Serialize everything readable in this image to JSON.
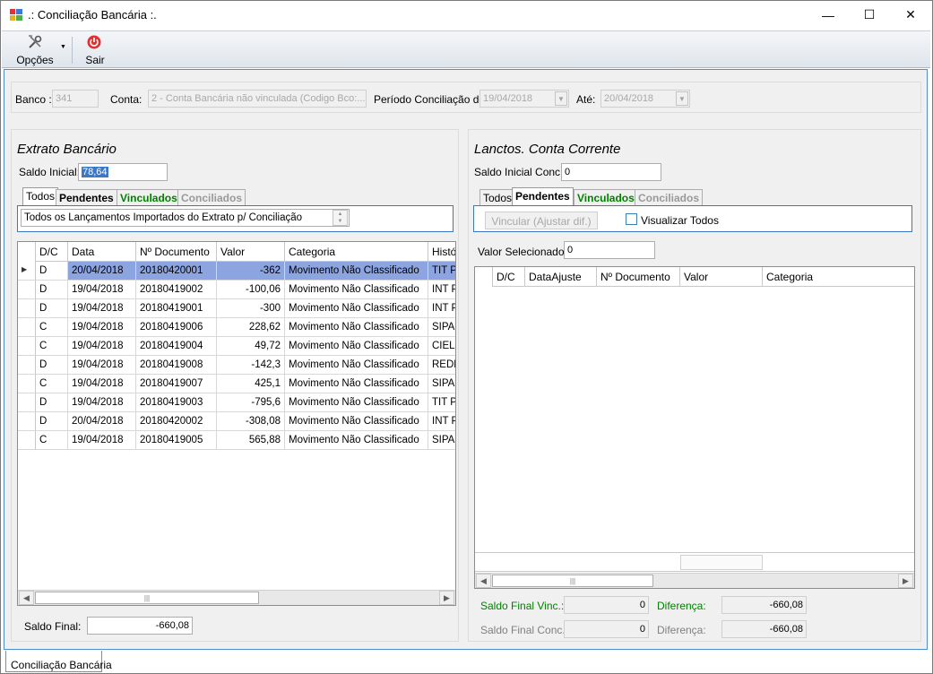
{
  "window": {
    "title": ".: Conciliação Bancária :.",
    "minimize_glyph": "—",
    "maximize_glyph": "☐",
    "close_glyph": "✕"
  },
  "toolbar": {
    "options_label": "Opções",
    "exit_label": "Sair"
  },
  "header": {
    "banco_label": "Banco :",
    "banco_value": "341",
    "conta_label": "Conta:",
    "conta_value": "2 - Conta Bancária não vinculada (Codigo Bco:...",
    "periodo_label": "Período Conciliação de :",
    "periodo_de": "19/04/2018",
    "ate_label": "Até:",
    "periodo_ate": "20/04/2018"
  },
  "left": {
    "title": "Extrato Bancário",
    "saldo_inicial_label": "Saldo Inicial:",
    "saldo_inicial_value": "78,64",
    "tabs": [
      "Todos",
      "Pendentes",
      "Vinculados",
      "Conciliados"
    ],
    "tab_description": "Todos os Lançamentos Importados do Extrato p/ Conciliação",
    "columns": [
      "D/C",
      "Data",
      "Nº Documento",
      "Valor",
      "Categoria",
      "Históri"
    ],
    "rows": [
      [
        "D",
        "20/04/2018",
        "20180420001",
        "-362",
        "Movimento Não Classificado",
        "TIT PA"
      ],
      [
        "D",
        "19/04/2018",
        "20180419002",
        "-100,06",
        "Movimento Não Classificado",
        "INT PA"
      ],
      [
        "D",
        "19/04/2018",
        "20180419001",
        "-300",
        "Movimento Não Classificado",
        "INT PA"
      ],
      [
        "C",
        "19/04/2018",
        "20180419006",
        "228,62",
        "Movimento Não Classificado",
        "SIPAG"
      ],
      [
        "C",
        "19/04/2018",
        "20180419004",
        "49,72",
        "Movimento Não Classificado",
        "CIELO"
      ],
      [
        "D",
        "19/04/2018",
        "20180419008",
        "-142,3",
        "Movimento Não Classificado",
        "REDE"
      ],
      [
        "C",
        "19/04/2018",
        "20180419007",
        "425,1",
        "Movimento Não Classificado",
        "SIPAG"
      ],
      [
        "D",
        "19/04/2018",
        "20180419003",
        "-795,6",
        "Movimento Não Classificado",
        "TIT PA"
      ],
      [
        "D",
        "20/04/2018",
        "20180420002",
        "-308,08",
        "Movimento Não Classificado",
        "INT PA"
      ],
      [
        "C",
        "19/04/2018",
        "20180419005",
        "565,88",
        "Movimento Não Classificado",
        "SIPAG"
      ]
    ],
    "saldo_final_label": "Saldo Final:",
    "saldo_final_value": "-660,08"
  },
  "right": {
    "title": "Lanctos. Conta Corrente",
    "saldo_inicial_label": "Saldo Inicial Conc.:",
    "saldo_inicial_value": "0",
    "tabs": [
      "Todos",
      "Pendentes",
      "Vinculados",
      "Conciliados"
    ],
    "vincular_label": "Vincular (Ajustar dif.)",
    "visualizar_label": "Visualizar Todos",
    "valor_sel_label": "Valor Selecionado:",
    "valor_sel_value": "0",
    "columns": [
      "D/C",
      "DataAjuste",
      "Nº Documento",
      "Valor",
      "Categoria"
    ],
    "saldo_final_vinc_label": "Saldo Final Vinc.:",
    "saldo_final_vinc_value": "0",
    "diferenca1_label": "Diferença:",
    "diferenca1_value": "-660,08",
    "saldo_final_conc_label": "Saldo Final Conc.:",
    "saldo_final_conc_value": "0",
    "diferenca2_label": "Diferença:",
    "diferenca2_value": "-660,08"
  },
  "bottom_tab_label": "Conciliação Bancária",
  "colors": {
    "accent_border": "#3b78c2",
    "selection": "#8ca4e0",
    "green": "#008000"
  }
}
